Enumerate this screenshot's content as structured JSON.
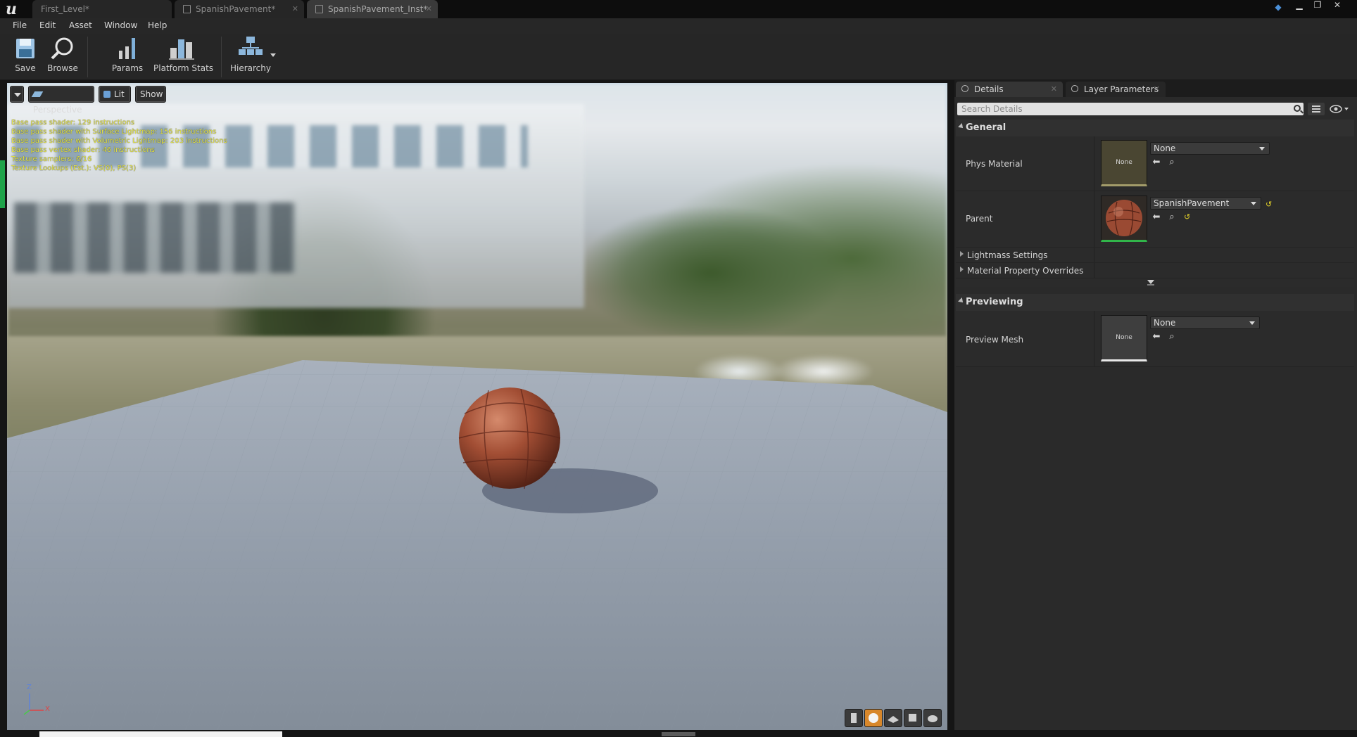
{
  "document_tabs": [
    {
      "label": "First_Level*"
    },
    {
      "label": "SpanishPavement*"
    },
    {
      "label": "SpanishPavement_Inst*"
    }
  ],
  "menu": [
    "File",
    "Edit",
    "Asset",
    "Window",
    "Help"
  ],
  "toolbar": {
    "save": "Save",
    "browse": "Browse",
    "params": "Params",
    "platform_stats": "Platform Stats",
    "hierarchy": "Hierarchy"
  },
  "viewport": {
    "perspective": "Perspective",
    "lit": "Lit",
    "show": "Show",
    "stats": [
      "Base pass shader: 129 instructions",
      "Base pass shader with Surface Lightmap: 156 instructions",
      "Base pass shader with Volumetric Lightmap: 203 instructions",
      "Base pass vertex shader: 46 instructions",
      "Texture samplers: 6/16",
      "Texture Lookups (Est.): VS(0), PS(3)"
    ],
    "axis_z": "Z",
    "axis_x": "X"
  },
  "details": {
    "tab_details": "Details",
    "tab_layer_params": "Layer Parameters",
    "search_placeholder": "Search Details",
    "general": "General",
    "phys_material_label": "Phys Material",
    "phys_material_thumb": "None",
    "phys_material_value": "None",
    "parent_label": "Parent",
    "parent_value": "SpanishPavement",
    "lightmass": "Lightmass Settings",
    "material_overrides": "Material Property Overrides",
    "previewing": "Previewing",
    "preview_mesh_label": "Preview Mesh",
    "preview_mesh_thumb": "None",
    "preview_mesh_value": "None"
  }
}
